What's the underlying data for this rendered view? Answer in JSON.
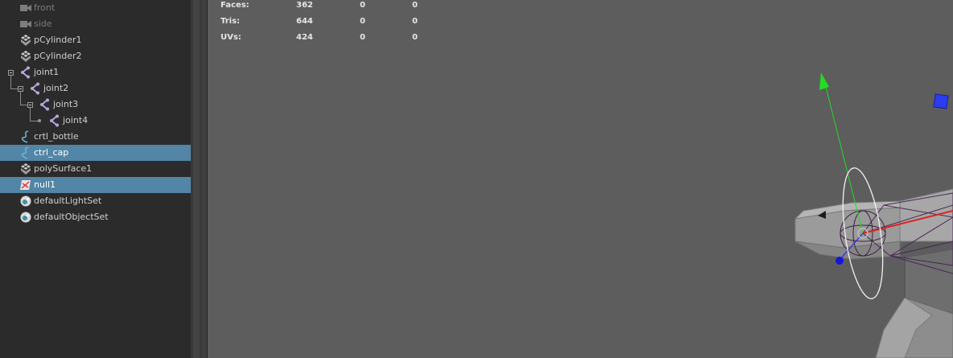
{
  "outliner": {
    "items": [
      {
        "id": "front",
        "label": "front",
        "type": "camera",
        "depth": 0,
        "dim": true,
        "selected": false
      },
      {
        "id": "side",
        "label": "side",
        "type": "camera",
        "depth": 0,
        "dim": true,
        "selected": false
      },
      {
        "id": "pCylinder1",
        "label": "pCylinder1",
        "type": "mesh",
        "depth": 0,
        "dim": false,
        "selected": false
      },
      {
        "id": "pCylinder2",
        "label": "pCylinder2",
        "type": "mesh",
        "depth": 0,
        "dim": false,
        "selected": false
      },
      {
        "id": "joint1",
        "label": "joint1",
        "type": "joint",
        "depth": 0,
        "dim": false,
        "selected": false
      },
      {
        "id": "joint2",
        "label": "joint2",
        "type": "joint",
        "depth": 1,
        "dim": false,
        "selected": false
      },
      {
        "id": "joint3",
        "label": "joint3",
        "type": "joint",
        "depth": 2,
        "dim": false,
        "selected": false
      },
      {
        "id": "joint4",
        "label": "joint4",
        "type": "joint",
        "depth": 3,
        "dim": false,
        "selected": false
      },
      {
        "id": "crtl_bottle",
        "label": "crtl_bottle",
        "type": "curve",
        "depth": 0,
        "dim": false,
        "selected": false
      },
      {
        "id": "ctrl_cap",
        "label": "ctrl_cap",
        "type": "curve",
        "depth": 0,
        "dim": false,
        "selected": true
      },
      {
        "id": "polySurface1",
        "label": "polySurface1",
        "type": "mesh",
        "depth": 0,
        "dim": false,
        "selected": false
      },
      {
        "id": "null1",
        "label": "null1",
        "type": "null",
        "depth": 0,
        "dim": false,
        "selected": true
      },
      {
        "id": "defaultLightSet",
        "label": "defaultLightSet",
        "type": "set",
        "depth": 0,
        "dim": false,
        "selected": false
      },
      {
        "id": "defaultObjectSet",
        "label": "defaultObjectSet",
        "type": "set",
        "depth": 0,
        "dim": false,
        "selected": false
      }
    ]
  },
  "hud": {
    "rows": [
      {
        "label": "Faces:",
        "c1": "362",
        "c2": "0",
        "c3": "0"
      },
      {
        "label": "Tris:",
        "c1": "644",
        "c2": "0",
        "c3": "0"
      },
      {
        "label": "UVs:",
        "c1": "424",
        "c2": "0",
        "c3": "0"
      }
    ]
  },
  "colors": {
    "panel_bg": "#2b2b2b",
    "selection": "#5285a6",
    "viewport_bg": "#5d5d5d",
    "joint_icon": "#b7a6e0",
    "axis_y": "#22dd22",
    "axis_x": "#dd2222",
    "axis_z": "#2222ee"
  }
}
